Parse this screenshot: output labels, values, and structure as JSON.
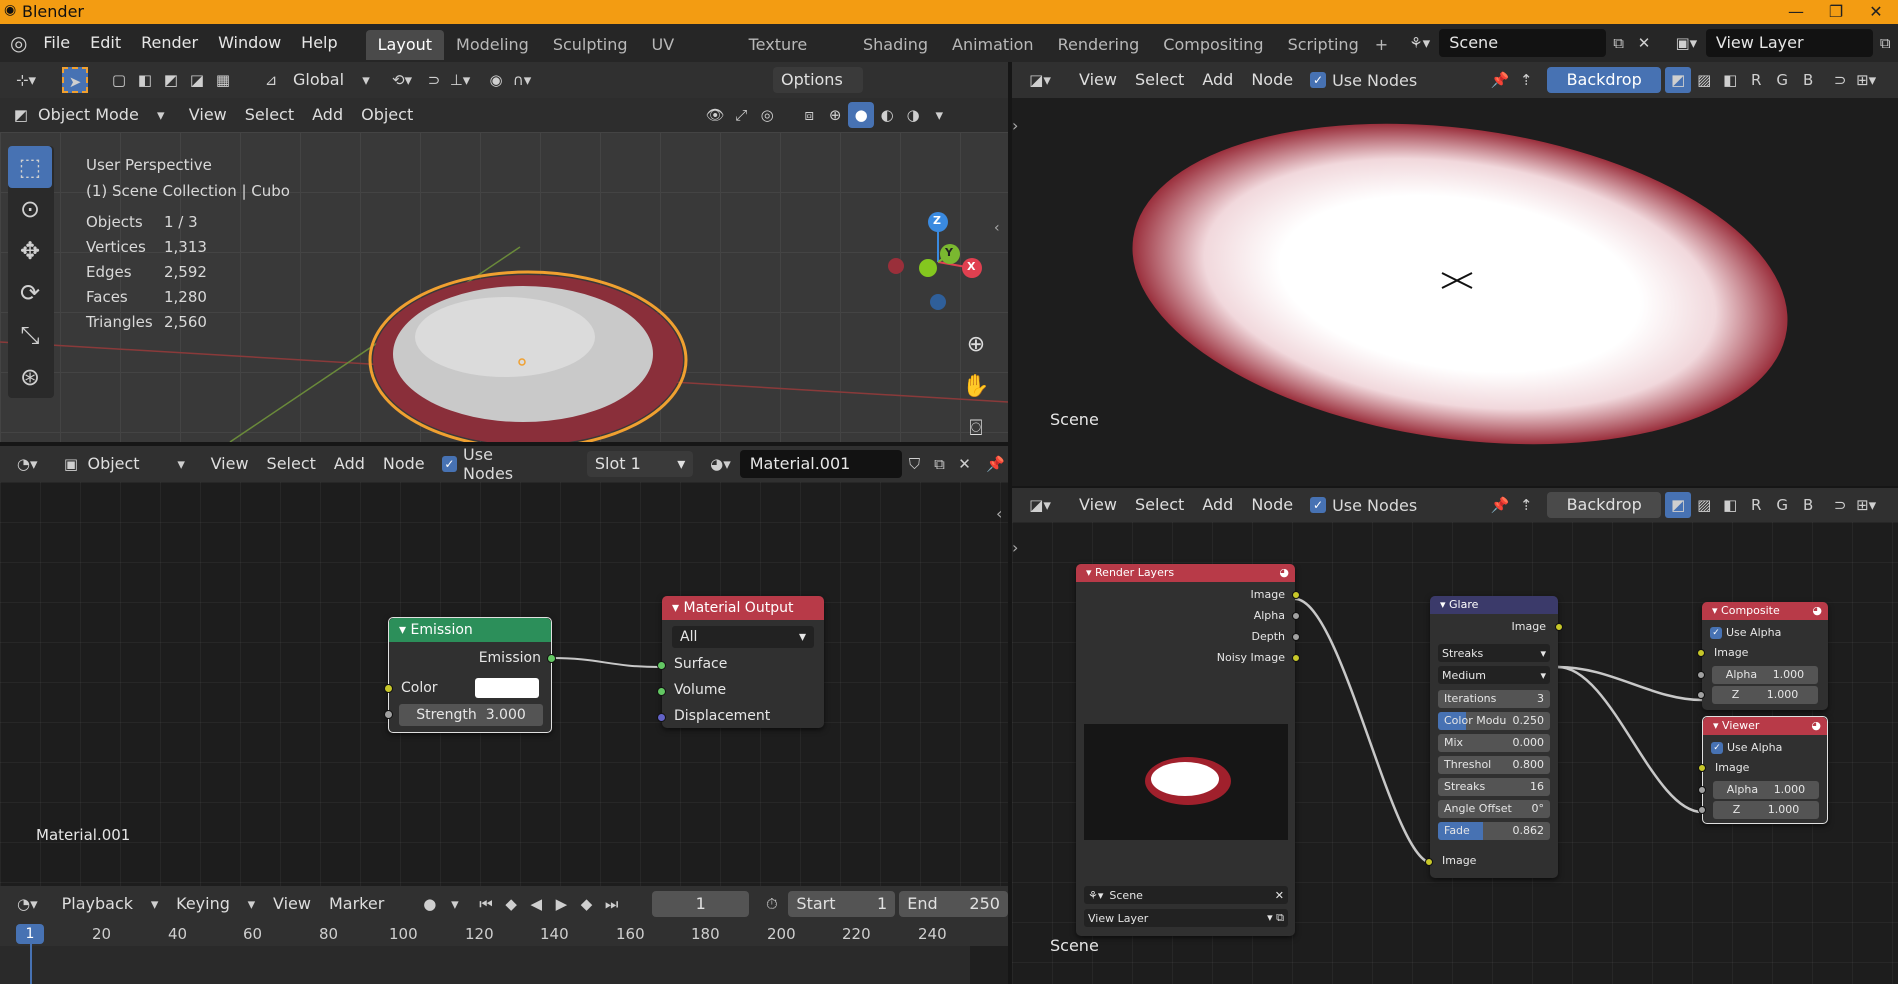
{
  "app": {
    "title": "Blender"
  },
  "menu": [
    "File",
    "Edit",
    "Render",
    "Window",
    "Help"
  ],
  "workspaces": [
    "Layout",
    "Modeling",
    "Sculpting",
    "UV Editing",
    "Texture Paint",
    "Shading",
    "Animation",
    "Rendering",
    "Compositing",
    "Scripting"
  ],
  "workspace_active": "Layout",
  "scene_field": "Scene",
  "view_layer_field": "View Layer",
  "viewport": {
    "orientation": "Global",
    "options": "Options",
    "mode": "Object Mode",
    "menus": [
      "View",
      "Select",
      "Add",
      "Object"
    ],
    "title": "User Perspective",
    "collection": "(1) Scene Collection | Cubo",
    "stats": [
      {
        "k": "Objects",
        "v": "1 / 3"
      },
      {
        "k": "Vertices",
        "v": "1,313"
      },
      {
        "k": "Edges",
        "v": "2,592"
      },
      {
        "k": "Faces",
        "v": "1,280"
      },
      {
        "k": "Triangles",
        "v": "2,560"
      }
    ],
    "gizmo": {
      "z": "Z",
      "y": "Y",
      "x": "X"
    }
  },
  "shader": {
    "type": "Object",
    "menus": [
      "View",
      "Select",
      "Add",
      "Node"
    ],
    "use_nodes": "Use Nodes",
    "slot": "Slot 1",
    "material": "Material.001",
    "footer": "Material.001",
    "emission": {
      "title": "Emission",
      "out": "Emission",
      "color": "Color",
      "strength": "Strength",
      "strength_val": "3.000"
    },
    "output": {
      "title": "Material Output",
      "target": "All",
      "surface": "Surface",
      "volume": "Volume",
      "displacement": "Displacement"
    }
  },
  "backdrop": {
    "menus": [
      "View",
      "Select",
      "Add",
      "Node"
    ],
    "use_nodes": "Use Nodes",
    "backdrop": "Backdrop",
    "channels": [
      "R",
      "G",
      "B"
    ],
    "label": "Scene"
  },
  "compositor": {
    "menus": [
      "View",
      "Select",
      "Add",
      "Node"
    ],
    "use_nodes": "Use Nodes",
    "backdrop": "Backdrop",
    "channels": [
      "R",
      "G",
      "B"
    ],
    "label": "Scene",
    "render_layers": {
      "title": "Render Layers",
      "outs": [
        "Image",
        "Alpha",
        "Depth",
        "Noisy Image"
      ],
      "scene": "Scene",
      "view_layer": "View Layer"
    },
    "glare": {
      "title": "Glare",
      "out": "Image",
      "type": "Streaks",
      "quality": "Medium",
      "props": [
        {
          "k": "Iterations",
          "v": "3"
        },
        {
          "k": "Color Modu",
          "v": "0.250"
        },
        {
          "k": "Mix",
          "v": "0.000"
        },
        {
          "k": "Threshol",
          "v": "0.800"
        },
        {
          "k": "Streaks",
          "v": "16"
        },
        {
          "k": "Angle Offset",
          "v": "0°"
        },
        {
          "k": "Fade",
          "v": "0.862"
        }
      ],
      "in": "Image"
    },
    "composite": {
      "title": "Composite",
      "use_alpha": "Use Alpha",
      "image": "Image",
      "alpha": "Alpha",
      "alpha_v": "1.000",
      "z": "Z",
      "z_v": "1.000"
    },
    "viewer": {
      "title": "Viewer",
      "use_alpha": "Use Alpha",
      "image": "Image",
      "alpha": "Alpha",
      "alpha_v": "1.000",
      "z": "Z",
      "z_v": "1.000"
    }
  },
  "timeline": {
    "menus": [
      "Playback",
      "Keying",
      "View",
      "Marker"
    ],
    "frame": "1",
    "start_label": "Start",
    "start": "1",
    "end_label": "End",
    "end": "250",
    "ticks": [
      "1",
      "20",
      "40",
      "60",
      "80",
      "100",
      "120",
      "140",
      "160",
      "180",
      "200",
      "220",
      "240"
    ]
  }
}
